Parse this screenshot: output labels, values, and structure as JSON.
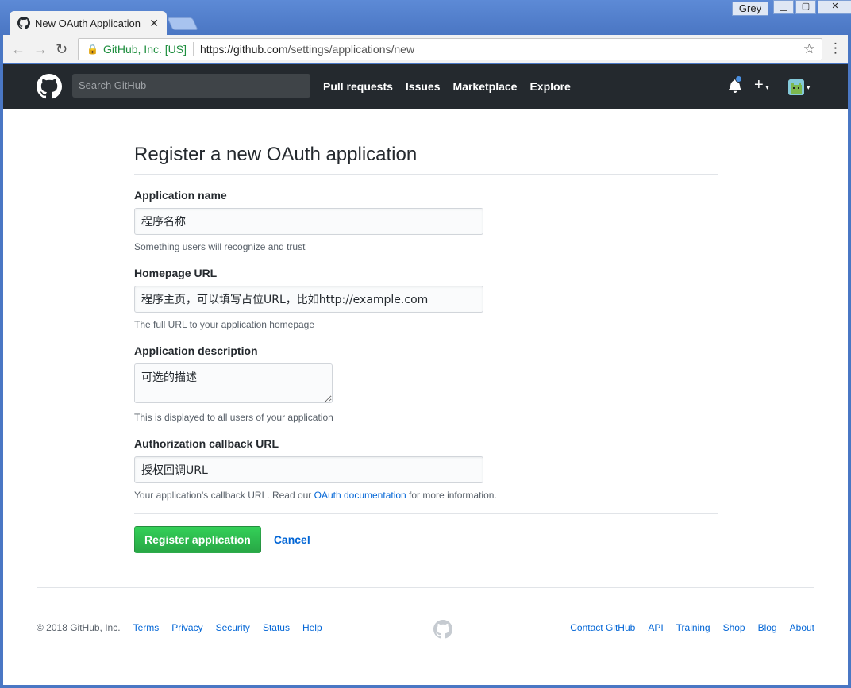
{
  "browser": {
    "tab_title": "New OAuth Application",
    "user_label": "Grey",
    "secure_label": "GitHub, Inc. [US]",
    "url_host": "https://github.com",
    "url_path": "/settings/applications/new"
  },
  "header": {
    "search_placeholder": "Search GitHub",
    "nav": [
      "Pull requests",
      "Issues",
      "Marketplace",
      "Explore"
    ]
  },
  "form": {
    "title": "Register a new OAuth application",
    "app_name": {
      "label": "Application name",
      "value": "程序名称",
      "note": "Something users will recognize and trust"
    },
    "homepage": {
      "label": "Homepage URL",
      "value": "程序主页，可以填写占位URL，比如http://example.com",
      "note": "The full URL to your application homepage"
    },
    "description": {
      "label": "Application description",
      "value": "可选的描述",
      "note": "This is displayed to all users of your application"
    },
    "callback": {
      "label": "Authorization callback URL",
      "value": "授权回调URL",
      "note_prefix": "Your application's callback URL. Read our ",
      "note_link": "OAuth documentation",
      "note_suffix": " for more information."
    },
    "submit_label": "Register application",
    "cancel_label": "Cancel"
  },
  "footer": {
    "copyright": "© 2018 GitHub, Inc.",
    "left_links": [
      "Terms",
      "Privacy",
      "Security",
      "Status",
      "Help"
    ],
    "right_links": [
      "Contact GitHub",
      "API",
      "Training",
      "Shop",
      "Blog",
      "About"
    ]
  },
  "colors": {
    "primary": "#28a745",
    "link": "#0366d6",
    "header_bg": "#24292e",
    "frame": "#4a77c4"
  }
}
